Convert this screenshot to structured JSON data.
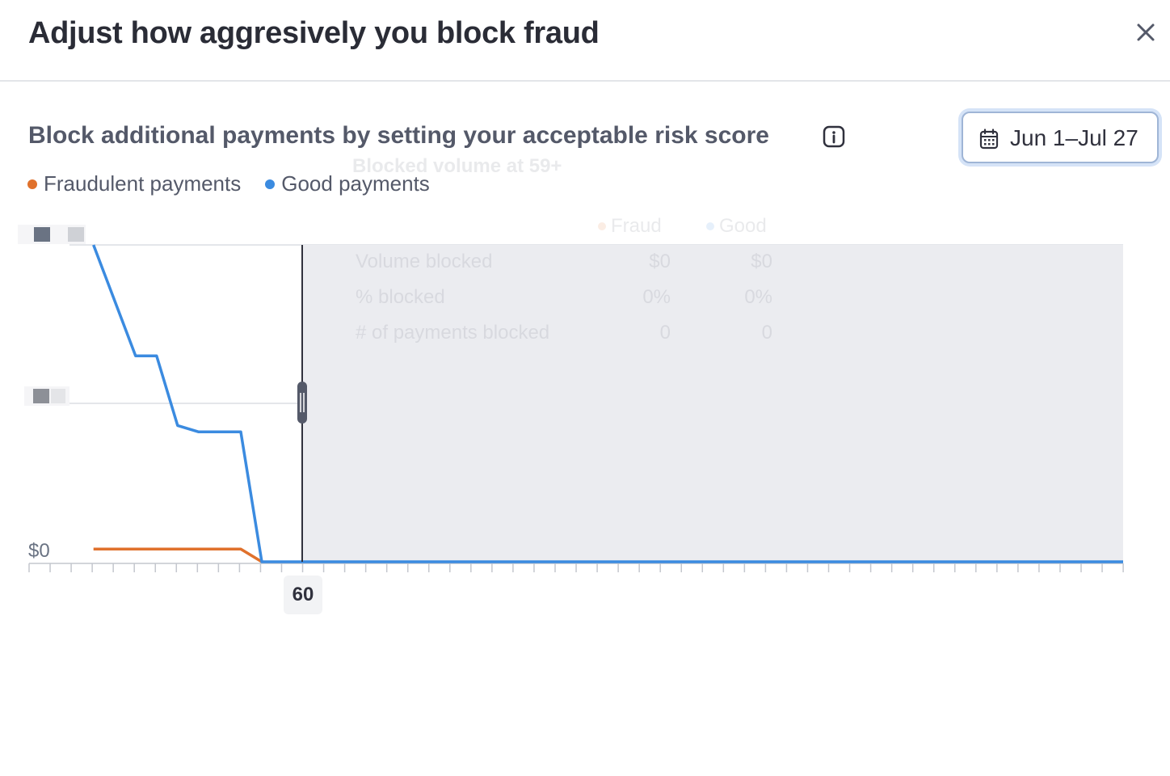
{
  "modal": {
    "title": "Adjust how aggresively you block fraud",
    "close_icon": "close-icon"
  },
  "section": {
    "title": "Block additional payments by setting your acceptable risk score",
    "info_icon": "info-icon"
  },
  "date_range": {
    "label": "Jun 1–Jul 27",
    "icon": "calendar-icon"
  },
  "legend": [
    {
      "label": "Fraudulent payments",
      "color": "#e0712c"
    },
    {
      "label": "Good payments",
      "color": "#3b8be0"
    }
  ],
  "axis": {
    "y_zero_label": "$0",
    "selected_score": "60"
  },
  "tooltip": {
    "title": "Blocked volume at 59+",
    "col_fraud": "Fraud",
    "col_good": "Good",
    "rows": [
      {
        "label": "Volume blocked",
        "fraud": "$0",
        "good": "$0"
      },
      {
        "label": "% blocked",
        "fraud": "0%",
        "good": "0%"
      },
      {
        "label": "# of payments blocked",
        "fraud": "0",
        "good": "0"
      }
    ]
  },
  "chart_data": {
    "type": "line",
    "x_label": "",
    "y_label": "",
    "xlim": [
      0,
      100
    ],
    "threshold": 60,
    "series": [
      {
        "name": "Good payments",
        "color": "#3b8be0",
        "x": [
          31,
          33,
          34,
          35,
          36,
          37,
          38,
          39,
          100
        ],
        "y": [
          1.0,
          0.65,
          0.65,
          0.43,
          0.41,
          0.41,
          0.41,
          0.0,
          0.0
        ]
      },
      {
        "name": "Fraudulent payments",
        "color": "#e0712c",
        "x": [
          31,
          38,
          39
        ],
        "y": [
          0.04,
          0.04,
          0.0
        ]
      }
    ]
  }
}
